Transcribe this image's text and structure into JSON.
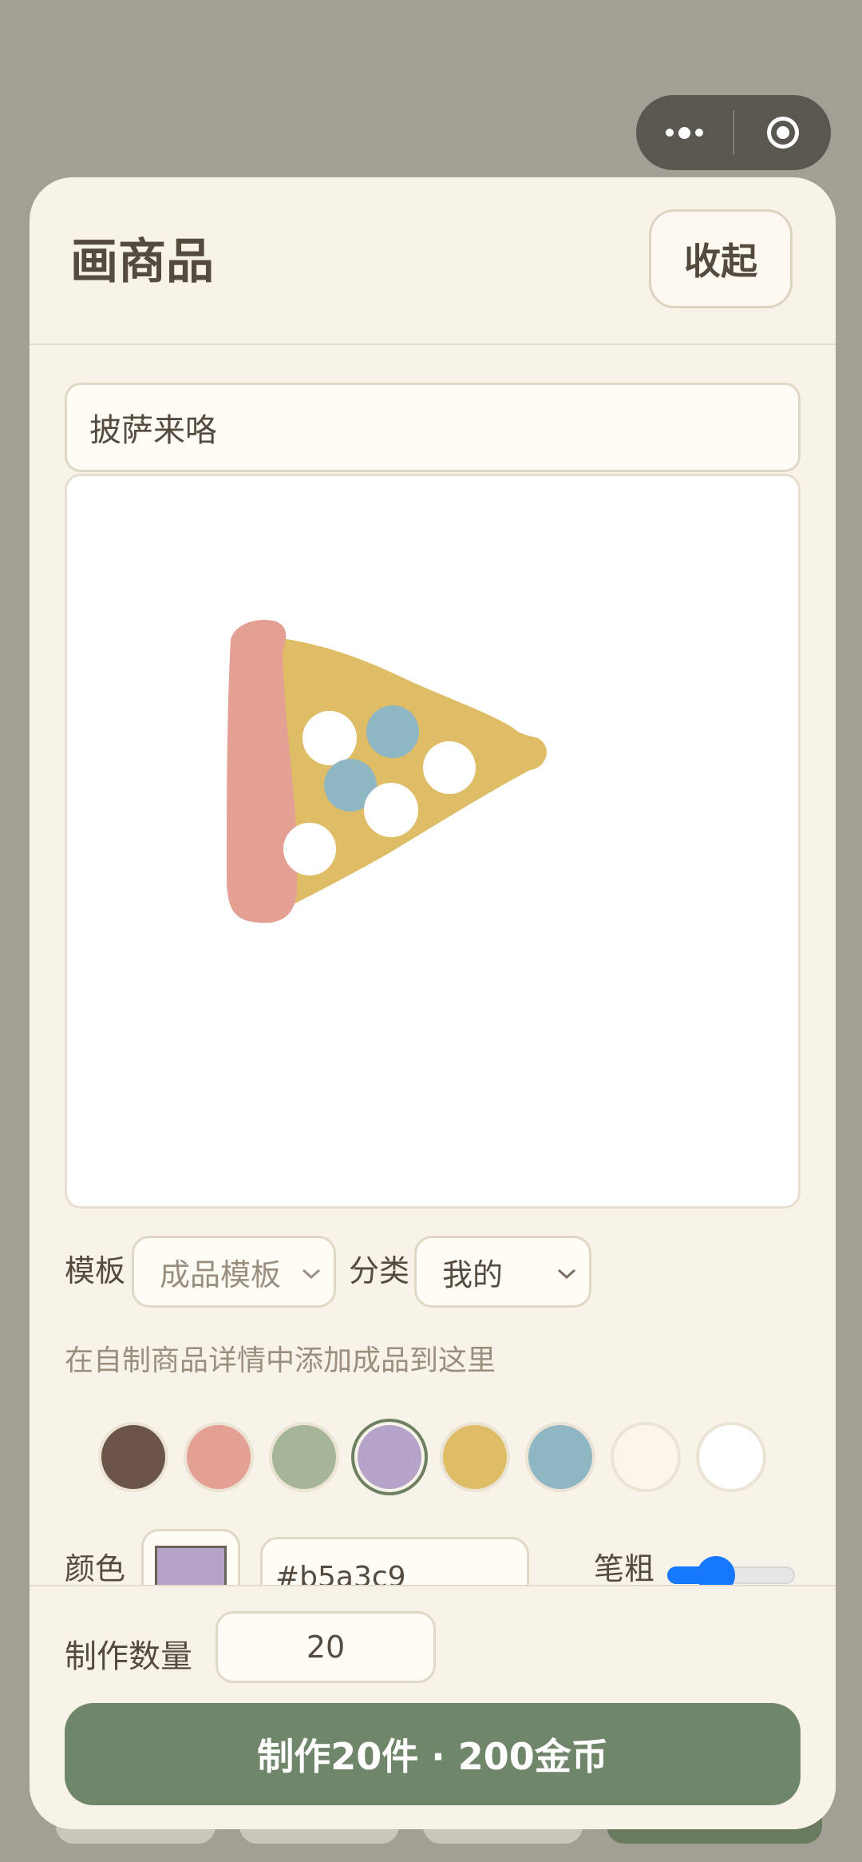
{
  "header": {
    "title": "画商品",
    "collapse_label": "收起"
  },
  "capsule": {
    "more_icon": "more-dots-icon",
    "close_icon": "target-circle-icon"
  },
  "product": {
    "name": "披萨来咯"
  },
  "canvas": {
    "drawing": "pizza-slice-drawing"
  },
  "options": {
    "template_label": "模板",
    "template_value": "成品模板",
    "category_label": "分类",
    "category_value": "我的",
    "hint": "在自制商品详情中添加成品到这里"
  },
  "palette": {
    "swatches": [
      "#6b5548",
      "#e5a094",
      "#a6b597",
      "#b5a3c9",
      "#dfbd66",
      "#8fb6c3",
      "#fcf6ea",
      "#ffffff"
    ],
    "selected": "#b5a3c9"
  },
  "pen": {
    "color_label": "颜色",
    "color_value": "#b5a3c9",
    "size_label": "笔粗",
    "size_fraction": 0.38,
    "slider_color": "#1677ff"
  },
  "footer": {
    "quantity_label": "制作数量",
    "quantity_value": "20",
    "make_button": "制作20件 · 200金币",
    "button_color": "#70866a"
  }
}
